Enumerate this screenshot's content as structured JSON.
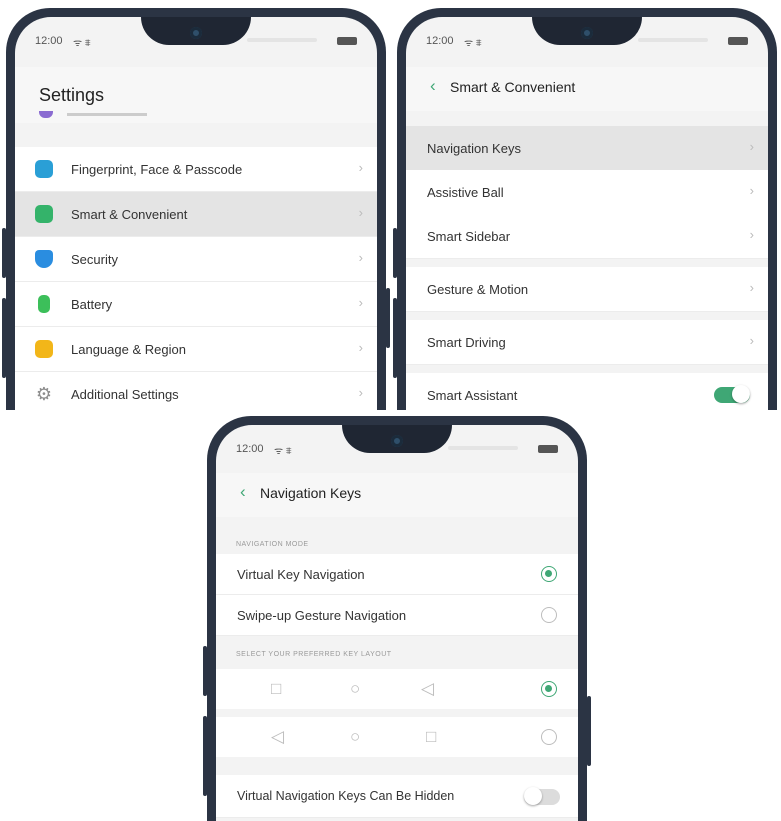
{
  "colors": {
    "accent": "#3fa775",
    "frame": "#2b3444",
    "selected_row": "#e4e4e4"
  },
  "status": {
    "time": "12:00",
    "signal": "ᯤ ⩨"
  },
  "screen1": {
    "title": "Settings",
    "items": [
      {
        "label": "Fingerprint, Face & Passcode",
        "icon": "fingerprint-icon",
        "color": "#2a9fd6"
      },
      {
        "label": "Smart & Convenient",
        "icon": "smart-convenient-icon",
        "color": "#34b36a"
      },
      {
        "label": "Security",
        "icon": "shield-icon",
        "color": "#2a8de0"
      },
      {
        "label": "Battery",
        "icon": "battery-icon",
        "color": "#3cbf5a"
      },
      {
        "label": "Language & Region",
        "icon": "language-icon",
        "color": "#f2b619"
      },
      {
        "label": "Additional Settings",
        "icon": "gear-icon",
        "color": "#8d8d8d"
      }
    ],
    "chevron": "›"
  },
  "screen2": {
    "back": "‹",
    "title": "Smart & Convenient",
    "items": [
      {
        "label": "Navigation Keys"
      },
      {
        "label": "Assistive Ball"
      },
      {
        "label": "Smart Sidebar"
      },
      {
        "label": "Gesture & Motion"
      },
      {
        "label": "Smart Driving"
      },
      {
        "label": "Smart Assistant"
      }
    ],
    "chevron": "›",
    "smart_assistant_on": true
  },
  "screen3": {
    "back": "‹",
    "title": "Navigation Keys",
    "section_mode": "NAVIGATION MODE",
    "mode_options": [
      {
        "label": "Virtual Key Navigation",
        "selected": true
      },
      {
        "label": "Swipe-up Gesture Navigation",
        "selected": false
      }
    ],
    "section_layout": "SELECT YOUR PREFERRED KEY LAYOUT",
    "layouts": [
      {
        "keys": [
          "□",
          "○",
          "◁"
        ],
        "selected": true
      },
      {
        "keys": [
          "◁",
          "○",
          "□"
        ],
        "selected": false
      }
    ],
    "hide_label": "Virtual Navigation Keys Can Be Hidden",
    "hide_enabled": false
  }
}
